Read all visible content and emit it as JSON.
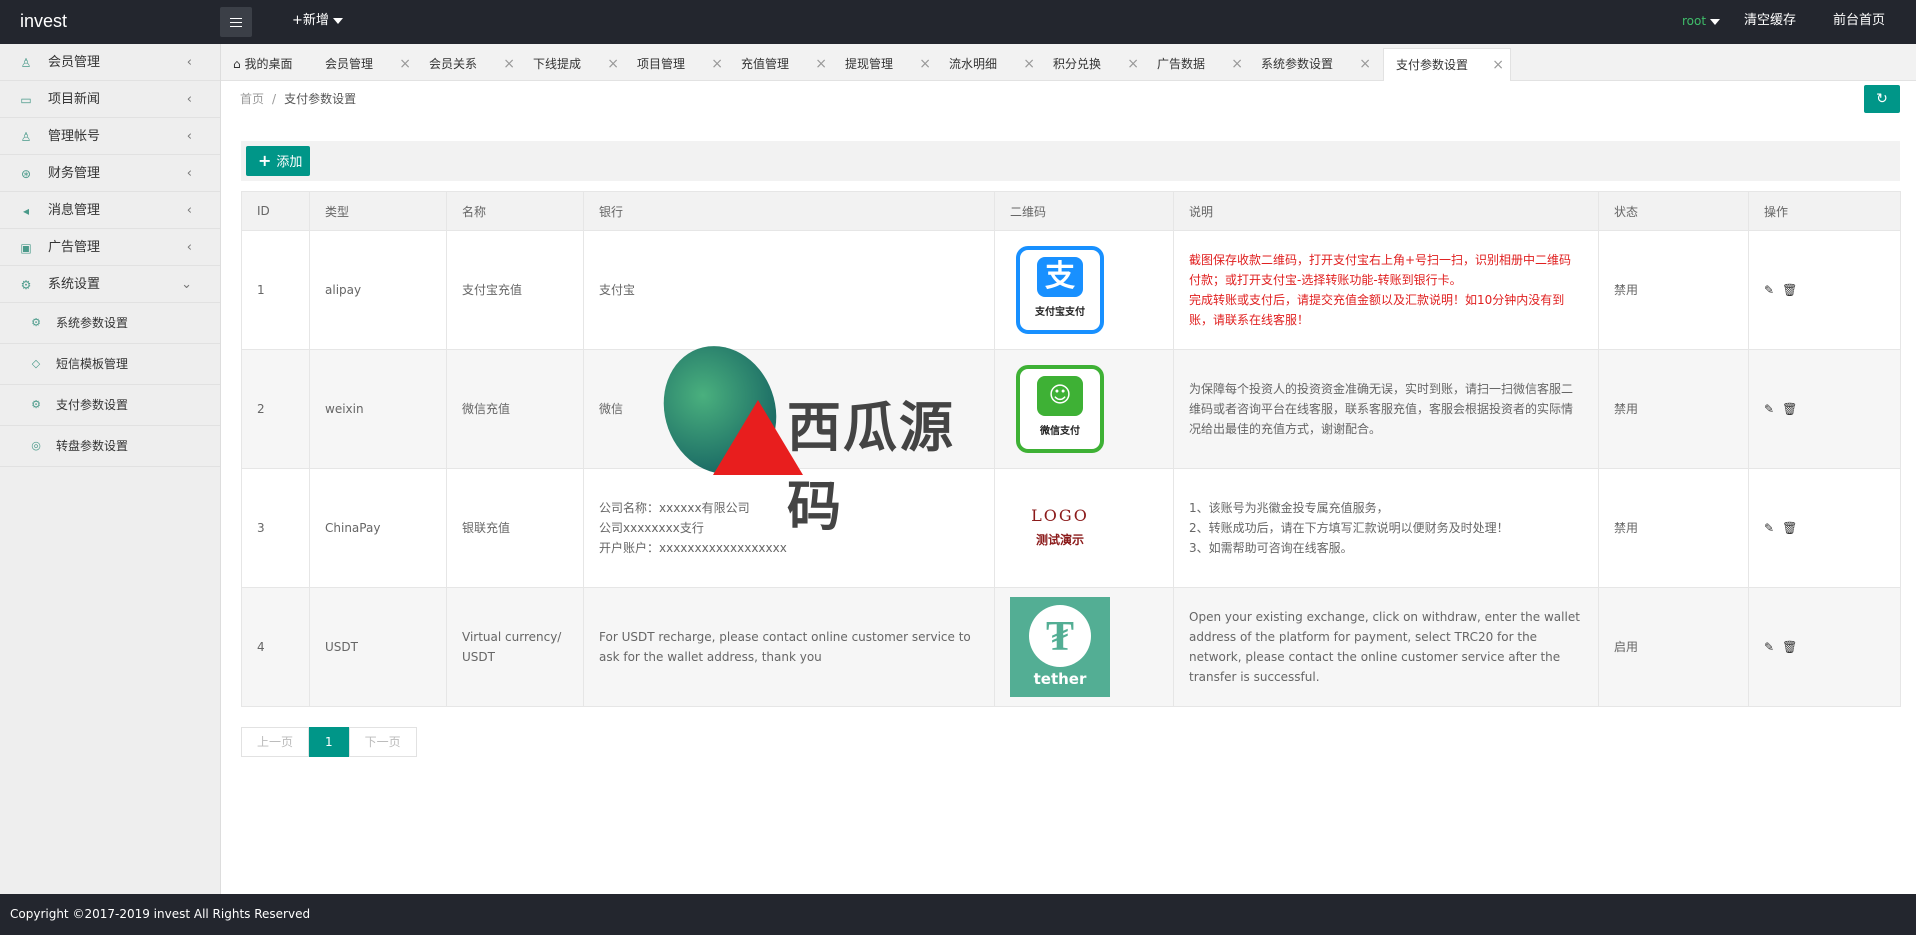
{
  "header": {
    "logo": "invest",
    "add_new": "+新增",
    "user": "root",
    "clear_cache": "清空缓存",
    "front_home": "前台首页"
  },
  "sidebar": {
    "items": [
      {
        "label": "会员管理",
        "icon": "user-icon",
        "glyph": "♙"
      },
      {
        "label": "项目新闻",
        "icon": "book-icon",
        "glyph": "▭"
      },
      {
        "label": "管理帐号",
        "icon": "admin-user-icon",
        "glyph": "♙"
      },
      {
        "label": "财务管理",
        "icon": "finance-icon",
        "glyph": "⊛"
      },
      {
        "label": "消息管理",
        "icon": "speaker-icon",
        "glyph": "◂"
      },
      {
        "label": "广告管理",
        "icon": "image-icon",
        "glyph": "▣"
      },
      {
        "label": "系统设置",
        "icon": "gear-icon",
        "glyph": "⚙"
      }
    ],
    "sub_items": [
      {
        "label": "系统参数设置",
        "icon": "gear-icon",
        "glyph": "⚙"
      },
      {
        "label": "短信模板管理",
        "icon": "tag-icon",
        "glyph": "◇"
      },
      {
        "label": "支付参数设置",
        "icon": "gear-icon",
        "glyph": "⚙"
      },
      {
        "label": "转盘参数设置",
        "icon": "wheel-icon",
        "glyph": "◎"
      }
    ]
  },
  "tabs": [
    "我的桌面",
    "会员管理",
    "会员关系",
    "下线提成",
    "项目管理",
    "充值管理",
    "提现管理",
    "流水明细",
    "积分兑换",
    "广告数据",
    "系统参数设置",
    "支付参数设置"
  ],
  "breadcrumb": {
    "home": "首页",
    "sep": "/",
    "current": "支付参数设置"
  },
  "toolbar": {
    "add_label": "添加"
  },
  "table": {
    "headers": [
      "ID",
      "类型",
      "名称",
      "银行",
      "二维码",
      "说明",
      "状态",
      "操作"
    ],
    "rows": [
      {
        "id": "1",
        "type": "alipay",
        "name": "支付宝充值",
        "bank": "支付宝",
        "qr_caption": "支付宝支付",
        "qr_glyph": "支",
        "desc": [
          "截图保存收款二维码，打开支付宝右上角+号扫一扫，识别相册中二维码付款；或打开支付宝-选择转账功能-转账到银行卡。",
          "完成转账或支付后，请提交充值金额以及汇款说明！如10分钟内没有到账，请联系在线客服！"
        ],
        "status": "禁用"
      },
      {
        "id": "2",
        "type": "weixin",
        "name": "微信充值",
        "bank": "微信",
        "qr_caption": "微信支付",
        "qr_glyph": "☺",
        "desc": [
          "为保障每个投资人的投资资金准确无误，实时到账，请扫一扫微信客服二维码或者咨询平台在线客服，联系客服充值，客服会根据投资者的实际情况给出最佳的充值方式，谢谢配合。"
        ],
        "status": "禁用"
      },
      {
        "id": "3",
        "type": "ChinaPay",
        "name": "银联充值",
        "bank": [
          "公司名称：xxxxxx有限公司",
          "公司xxxxxxxx支行",
          "开户账户：xxxxxxxxxxxxxxxxxx"
        ],
        "qr_logo_1": "LOGO",
        "qr_logo_2": "测试演示",
        "desc": [
          "1、该账号为兆徽金投专属充值服务，",
          "2、转账成功后，请在下方填写汇款说明以便财务及时处理！",
          "3、如需帮助可咨询在线客服。"
        ],
        "status": "禁用"
      },
      {
        "id": "4",
        "type": "USDT",
        "name": "Virtual currency/USDT",
        "bank": "For USDT recharge, please contact online customer service to ask for the wallet address, thank you",
        "qr_glyph": "₮",
        "qr_caption": "tether",
        "desc": [
          "Open your existing exchange, click on withdraw, enter the wallet address of the platform for payment, select TRC20 for the network, please contact the online customer service after the transfer is successful."
        ],
        "status": "启用"
      }
    ]
  },
  "watermark": "西瓜源码",
  "pager": {
    "prev": "上一页",
    "page": "1",
    "next": "下一页"
  },
  "footer": "Copyright ©2017-2019 invest All Rights Reserved",
  "colors": {
    "accent": "#009688",
    "header_bg": "#23262e",
    "warning_text": "#e02020"
  }
}
